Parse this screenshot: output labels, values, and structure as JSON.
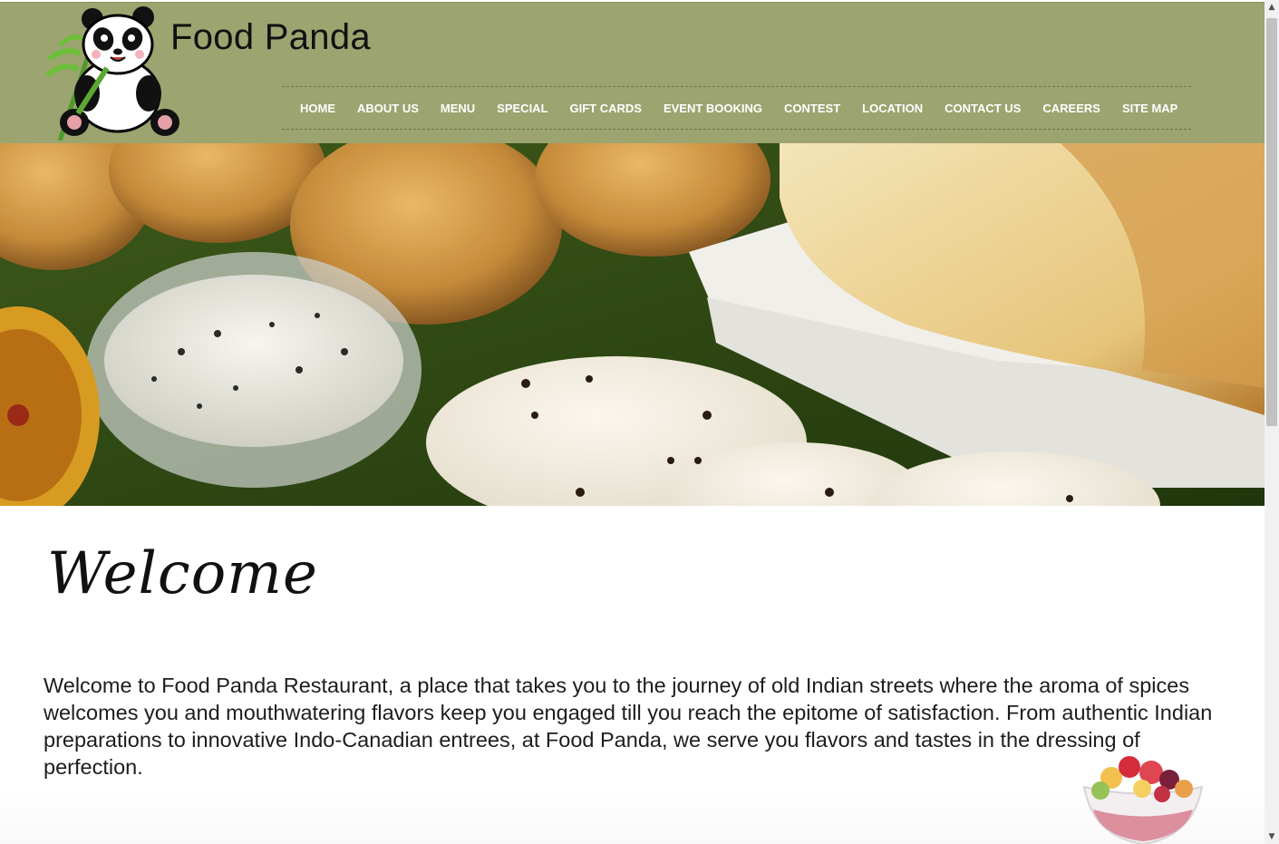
{
  "header": {
    "site_title": "Food Panda",
    "logo_icon": "panda-logo-icon",
    "bg_color": "#9ca470",
    "nav": [
      {
        "label": "HOME"
      },
      {
        "label": "ABOUT US"
      },
      {
        "label": "MENU"
      },
      {
        "label": "SPECIAL"
      },
      {
        "label": "GIFT CARDS"
      },
      {
        "label": "EVENT BOOKING"
      },
      {
        "label": "CONTEST"
      },
      {
        "label": "LOCATION"
      },
      {
        "label": "CONTACT US"
      },
      {
        "label": "CAREERS"
      },
      {
        "label": "SITE MAP"
      }
    ]
  },
  "hero": {
    "image": "south-indian-food-banner"
  },
  "welcome": {
    "title": "Welcome",
    "text": "Welcome to Food Panda Restaurant, a place that takes you to the journey of old Indian streets where the aroma of spices welcomes you and mouthwatering flavors keep you engaged till you reach the epitome of satisfaction. From authentic Indian preparations to innovative Indo-Canadian entrees, at Food Panda, we serve you flavors and tastes in the dressing of perfection."
  },
  "decor": {
    "dessert_image": "fruit-cup-image"
  },
  "scrollbar": {
    "up_icon": "scroll-up-arrow-icon",
    "down_icon": "scroll-down-arrow-icon"
  }
}
